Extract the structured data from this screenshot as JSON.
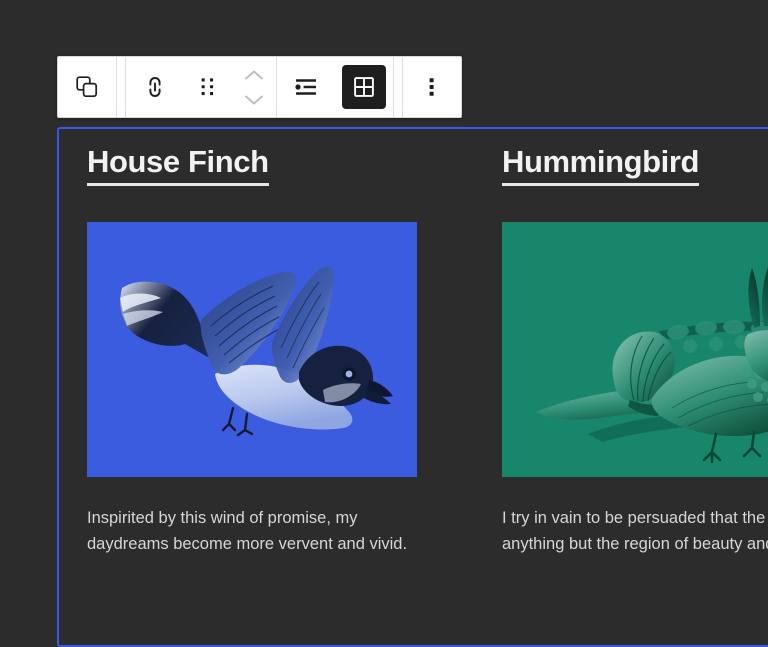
{
  "app": {
    "background_color": "#2c2c2c",
    "selection_color": "#3858e9"
  },
  "toolbar": {
    "name": "block-toolbar",
    "groups": [
      {
        "name": "block-type-group",
        "buttons": [
          {
            "name": "block-type-icon",
            "icon": "copy-blocks-icon",
            "label": "Query Loop",
            "state": "default"
          }
        ]
      },
      {
        "name": "block-actions-group",
        "buttons": [
          {
            "name": "link-button",
            "icon": "link-icon",
            "label": "Link",
            "state": "default"
          },
          {
            "name": "drag-handle",
            "icon": "drag-handle-icon",
            "label": "Drag",
            "state": "default"
          },
          {
            "name": "move-up-button",
            "icon": "chevron-up-icon",
            "label": "Move up",
            "state": "disabled"
          },
          {
            "name": "move-down-button",
            "icon": "chevron-down-icon",
            "label": "Move down",
            "state": "disabled"
          }
        ]
      },
      {
        "name": "layout-group",
        "buttons": [
          {
            "name": "list-view-button",
            "icon": "list-view-icon",
            "label": "List view",
            "state": "default"
          },
          {
            "name": "grid-view-button",
            "icon": "grid-view-icon",
            "label": "Grid view",
            "state": "pressed"
          }
        ]
      },
      {
        "name": "options-group",
        "buttons": [
          {
            "name": "more-options-button",
            "icon": "kebab-menu-icon",
            "label": "Options",
            "state": "default"
          }
        ]
      }
    ]
  },
  "grid": {
    "name": "post-template-grid",
    "columns": 2,
    "posts": [
      {
        "title": "House Finch",
        "image": {
          "name": "bird-illustration-blue",
          "alt": "Duotone engraving of a flying finch",
          "duotone_background": "#3c5ce0",
          "duotone_shadow": "#101c3a",
          "duotone_highlight": "#c9d6f5"
        },
        "excerpt_lines": [
          "Inspirited by this wind of promise, my",
          "daydreams become more vervent and vivid."
        ]
      },
      {
        "title": "Hummingbird",
        "image": {
          "name": "bird-illustration-green",
          "alt": "Duotone engraving of a perched hummingbird",
          "duotone_background": "#17866b",
          "duotone_shadow": "#0a3c2f",
          "duotone_highlight": "#89c6b2"
        },
        "excerpt_lines": [
          "I try in vain to be persuaded that the",
          "anything but the region of beauty and"
        ]
      }
    ]
  }
}
